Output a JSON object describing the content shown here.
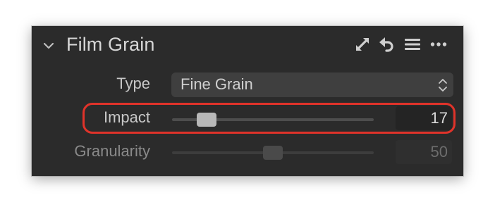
{
  "panel": {
    "title": "Film Grain",
    "header_icons": [
      "expand-icon",
      "reset-icon",
      "menu-icon",
      "more-icon"
    ]
  },
  "rows": {
    "type": {
      "label": "Type",
      "value": "Fine Grain"
    },
    "impact": {
      "label": "Impact",
      "value": "17",
      "slider_fraction": 0.17
    },
    "granularity": {
      "label": "Granularity",
      "value": "50",
      "slider_fraction": 0.5
    }
  },
  "colors": {
    "panel_bg": "#2b2b2b",
    "highlight": "#e0332a"
  }
}
